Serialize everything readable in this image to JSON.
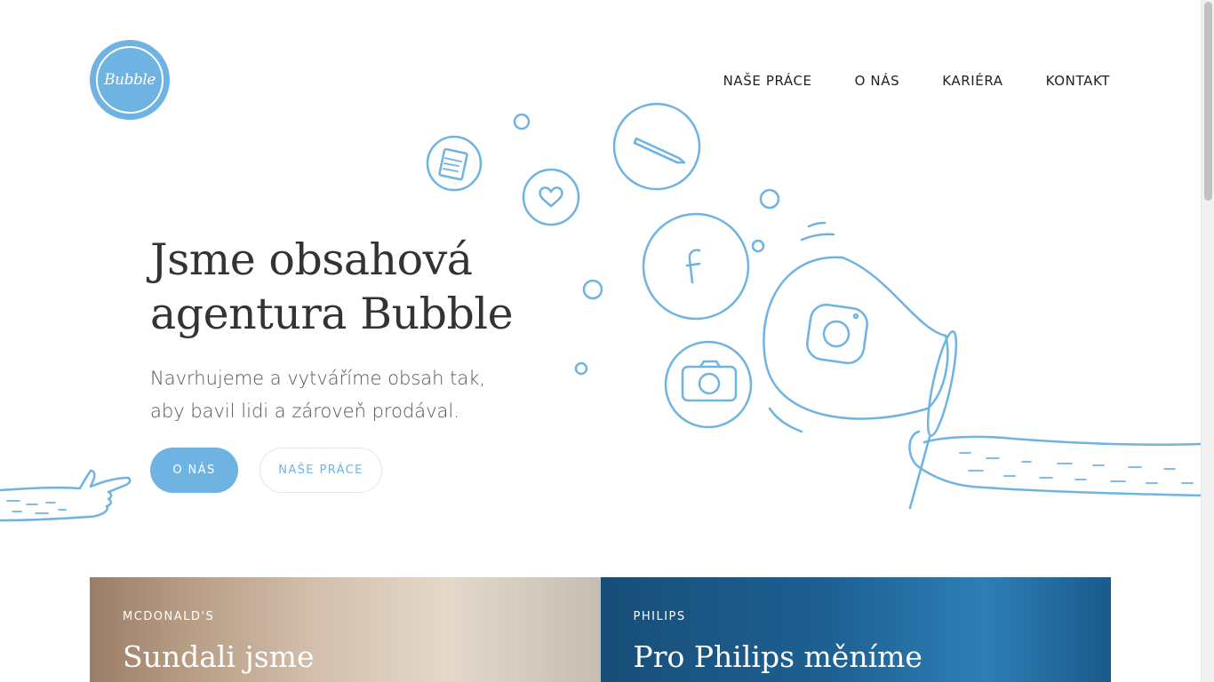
{
  "brand": {
    "logo_text": "Bubble",
    "accent": "#6fb3e3"
  },
  "nav": [
    {
      "label": "NAŠE PRÁCE"
    },
    {
      "label": "O NÁS"
    },
    {
      "label": "KARIÉRA"
    },
    {
      "label": "KONTAKT"
    }
  ],
  "hero": {
    "title": "Jsme obsahová agentura Bubble",
    "subtitle": "Navrhujeme a vytváříme obsah tak, aby bavil lidi a zároveň prodával.",
    "primary_button": "O NÁS",
    "secondary_button": "NAŠE PRÁCE"
  },
  "illustration_icons": [
    "notepad-icon",
    "heart-icon",
    "pencil-icon",
    "facebook-icon",
    "camera-icon",
    "instagram-icon"
  ],
  "cards": [
    {
      "kicker": "MCDONALD'S",
      "title": "Sundali jsme"
    },
    {
      "kicker": "PHILIPS",
      "title": "Pro Philips měníme"
    }
  ]
}
